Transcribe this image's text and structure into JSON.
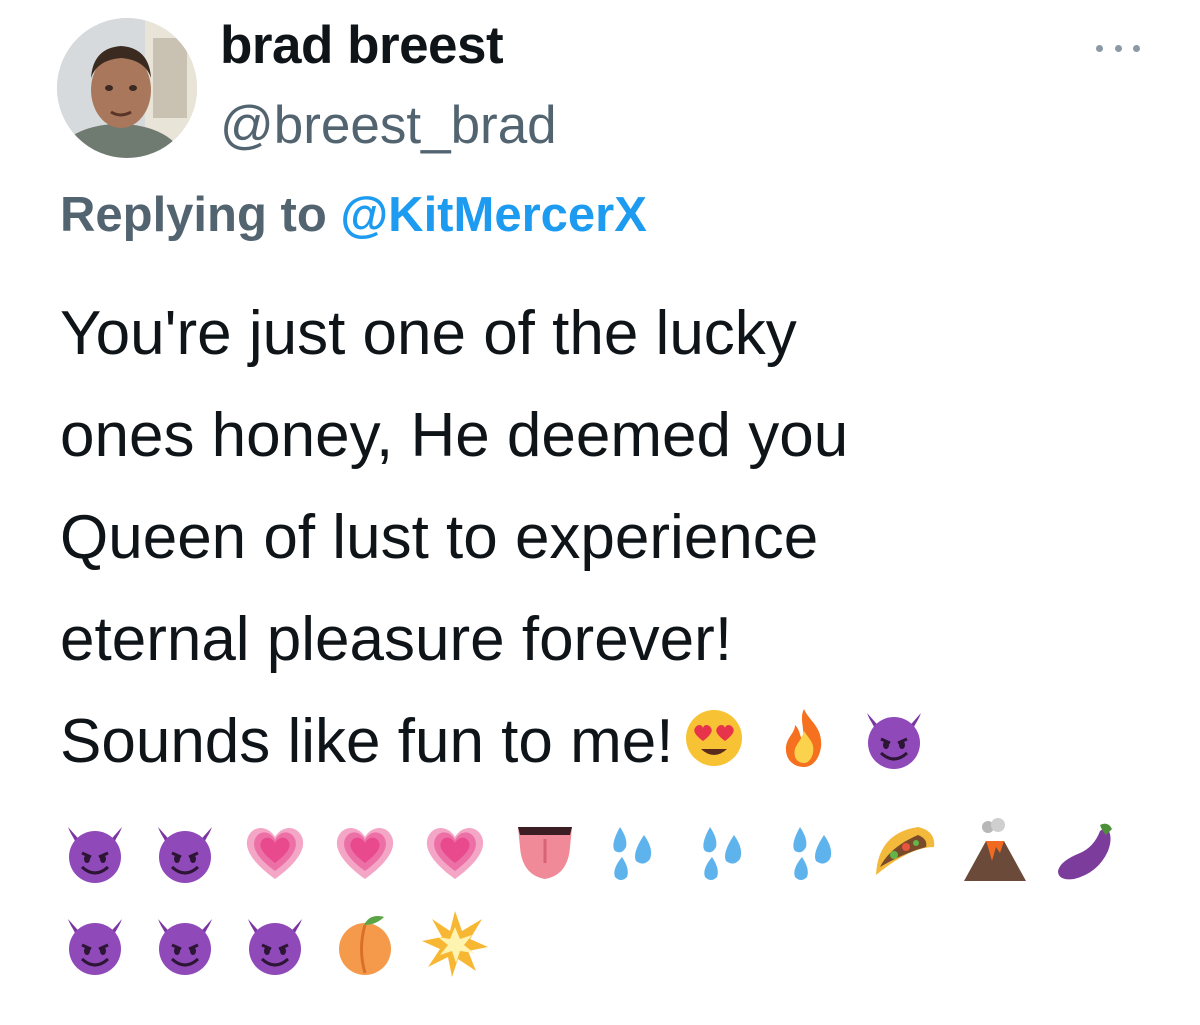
{
  "author": {
    "display_name": "brad breest",
    "handle": "@breest_brad"
  },
  "reply": {
    "prefix": "Replying to",
    "mention": "@KitMercerX"
  },
  "tweet_text": {
    "line1": "You're just one of the lucky",
    "line2": "ones honey, He deemed you",
    "line3": "Queen of lust to experience",
    "line4": "eternal pleasure forever!",
    "line5": "Sounds like fun to me!"
  },
  "emojis": {
    "line5": [
      "😍",
      "🔥",
      "😈"
    ],
    "row2": [
      "😈",
      "😈",
      "💗",
      "💗",
      "💗",
      "👅",
      "💦",
      "💦",
      "💦",
      "🌮",
      "🌋",
      "🍆"
    ],
    "row3": [
      "😈",
      "😈",
      "😈",
      "🍑",
      "💥"
    ]
  },
  "colors": {
    "text": "#0f1419",
    "secondary": "#536471",
    "link": "#1d9bf0"
  },
  "icons": {
    "more": "more-dots-icon"
  }
}
